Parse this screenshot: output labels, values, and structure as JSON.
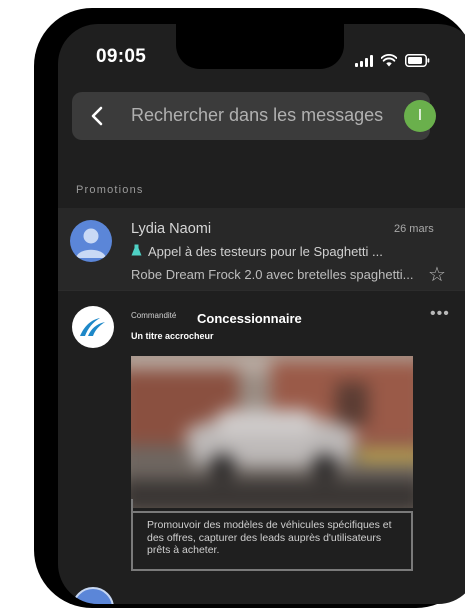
{
  "status": {
    "time": "09:05"
  },
  "search": {
    "placeholder": "Rechercher dans les messages",
    "account_initial": "I"
  },
  "section": {
    "label": "Promotions"
  },
  "message": {
    "sender": "Lydia Naomi",
    "date": "26 mars",
    "subject": "Appel à des testeurs pour le Spaghetti ...",
    "snippet": "Robe Dream Frock 2.0 avec bretelles spaghetti..."
  },
  "ad": {
    "sponsored_label": "Commandité",
    "advertiser": "Concessionnaire",
    "headline": "Un titre accrocheur",
    "more_label": "•••",
    "description": "Promouvoir des modèles de véhicules spécifiques et des offres, capturer des leads auprès d'utilisateurs prêts à acheter."
  },
  "colors": {
    "accent_avatar": "#6ab04c",
    "ad_logo": "#1e88c8",
    "sender_avatar": "#5b86d8"
  }
}
